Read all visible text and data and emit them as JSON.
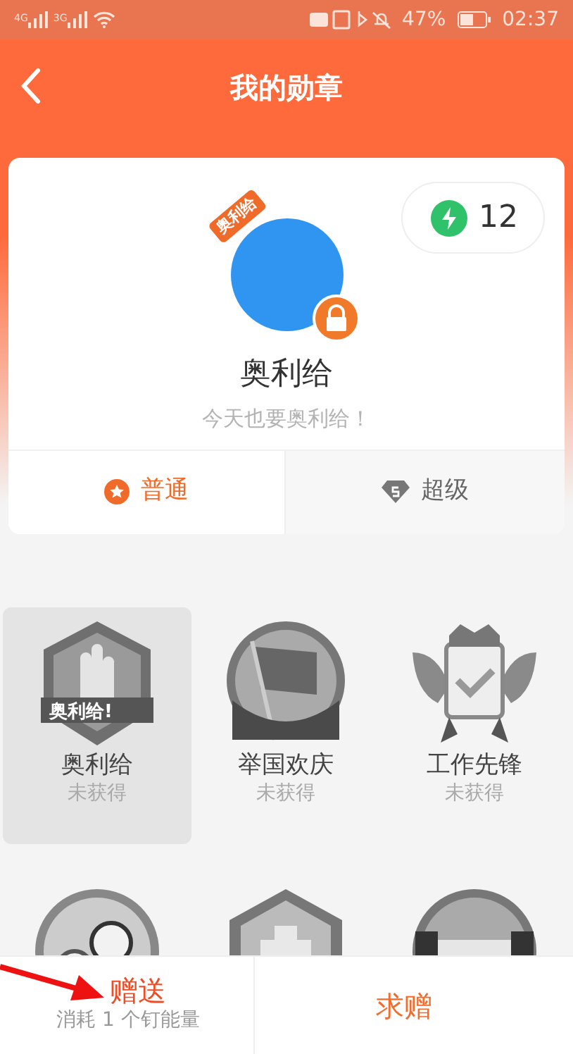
{
  "status_bar": {
    "signal_labels": [
      "4G",
      "3G"
    ],
    "battery": "47%",
    "time": "02:37"
  },
  "header": {
    "title": "我的勋章"
  },
  "profile": {
    "energy": "12",
    "frame_label": "奥利给",
    "locked": true,
    "name": "奥利给",
    "motto": "今天也要奥利给！"
  },
  "tabs": [
    {
      "label": "普通",
      "kind": "star",
      "selected": true
    },
    {
      "label": "超级",
      "kind": "diamond",
      "selected": false
    }
  ],
  "badges": [
    {
      "kind": "hexagon",
      "banner": "奥利给!",
      "name": "奥利给",
      "status": "未获得",
      "selected": true
    },
    {
      "kind": "flag",
      "name": "举国欢庆",
      "status": "未获得",
      "selected": false
    },
    {
      "kind": "wings",
      "name": "工作先锋",
      "status": "未获得",
      "selected": false
    },
    {
      "kind": "people",
      "selected": false
    },
    {
      "kind": "hands",
      "selected": false
    },
    {
      "kind": "handshake",
      "selected": false
    }
  ],
  "actions": [
    {
      "label": "赠送",
      "note": "消耗 1 个钉能量"
    },
    {
      "label": "求赠"
    }
  ],
  "annotation_arrow": true
}
